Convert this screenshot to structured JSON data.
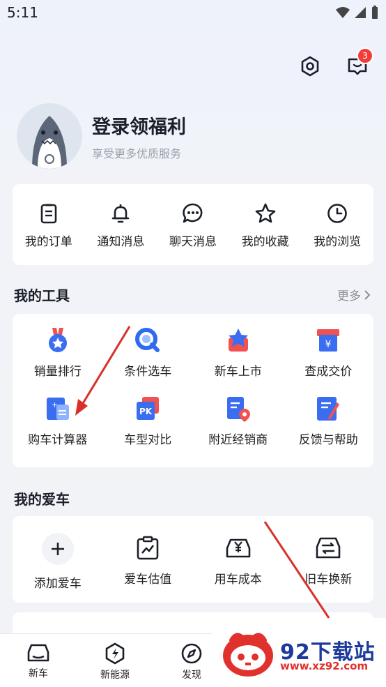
{
  "status_bar": {
    "time": "5:11"
  },
  "header": {
    "notification_count": "3"
  },
  "profile": {
    "title": "登录领福利",
    "subtitle": "享受更多优质服务"
  },
  "quick_actions": [
    {
      "label": "我的订单",
      "icon": "clipboard-icon"
    },
    {
      "label": "通知消息",
      "icon": "bell-icon"
    },
    {
      "label": "聊天消息",
      "icon": "chat-bubble-icon"
    },
    {
      "label": "我的收藏",
      "icon": "star-icon"
    },
    {
      "label": "我的浏览",
      "icon": "clock-icon"
    }
  ],
  "tools": {
    "title": "我的工具",
    "more": "更多",
    "items": [
      {
        "label": "销量排行",
        "icon": "medal-icon"
      },
      {
        "label": "条件选车",
        "icon": "search-filter-icon"
      },
      {
        "label": "新车上市",
        "icon": "new-car-star-icon"
      },
      {
        "label": "查成交价",
        "icon": "price-tag-icon"
      },
      {
        "label": "购车计算器",
        "icon": "calculator-icon"
      },
      {
        "label": "车型对比",
        "icon": "pk-compare-icon"
      },
      {
        "label": "附近经销商",
        "icon": "location-doc-icon"
      },
      {
        "label": "反馈与帮助",
        "icon": "feedback-edit-icon"
      }
    ]
  },
  "my_car": {
    "title": "我的爱车",
    "items": [
      {
        "label": "添加爱车",
        "icon": "plus-icon"
      },
      {
        "label": "爱车估值",
        "icon": "valuation-chart-icon"
      },
      {
        "label": "用车成本",
        "icon": "yen-car-icon"
      },
      {
        "label": "旧车换新",
        "icon": "car-swap-icon"
      }
    ]
  },
  "bottom_nav": [
    {
      "label": "新车",
      "icon": "car-front-icon"
    },
    {
      "label": "新能源",
      "icon": "lightning-icon"
    },
    {
      "label": "发现",
      "icon": "compass-icon"
    }
  ],
  "watermark": {
    "name": "92下载站",
    "url": "www.xz92.com"
  },
  "colors": {
    "accent_blue": "#2f6bf0",
    "accent_red": "#f23c3c",
    "background": "#f2f3f6"
  }
}
